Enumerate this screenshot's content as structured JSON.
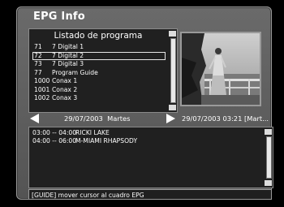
{
  "window": {
    "title": "EPG Info"
  },
  "program_list": {
    "title": "Listado de programa",
    "items": [
      {
        "num": "71",
        "name": "7 Digital 1"
      },
      {
        "num": "72",
        "name": "7 Digital 2",
        "selected": true
      },
      {
        "num": "73",
        "name": "7 Digital 3"
      },
      {
        "num": "77",
        "name": "Program Guide"
      },
      {
        "num": "1000",
        "name": "Conax 1"
      },
      {
        "num": "1001",
        "name": "Conax 2"
      },
      {
        "num": "1002",
        "name": "Conax 3"
      }
    ]
  },
  "date_nav": {
    "current_date": "29/07/2003",
    "day": "Martes",
    "now": "29/07/2003  03:21  [Mart..."
  },
  "events": [
    {
      "time": "03:00 -- 04:00",
      "title": "RICKI LAKE"
    },
    {
      "time": "04:00 -- 06:00",
      "title": "M-MIAMI RHAPSODY"
    }
  ],
  "hint": "[GUIDE] mover cursor al cuadro EPG",
  "colors": {
    "frame": "#5e5e5e",
    "panel": "#202020",
    "text": "#ffffff"
  }
}
